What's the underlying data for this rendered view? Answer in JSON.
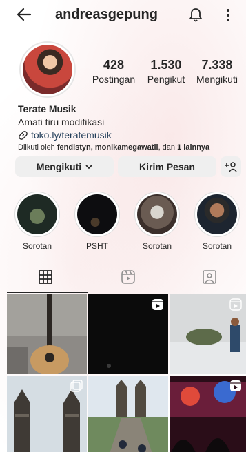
{
  "header": {
    "back_label": "←",
    "username": "andreasgepung",
    "more_label": "⋮"
  },
  "profile": {
    "stats": [
      {
        "value": "428",
        "label": "Postingan"
      },
      {
        "value": "1.530",
        "label": "Pengikut"
      },
      {
        "value": "7.338",
        "label": "Mengikuti"
      }
    ],
    "name": "Terate Musik",
    "bio": "Amati tiru modifikasi",
    "link": "toko.ly/teratemusik",
    "followed_by_prefix": "Diikuti oleh ",
    "followed_by_users": "fendistyn, monikamegawatii",
    "followed_by_middle": ", dan ",
    "followed_by_count": "1 lainnya"
  },
  "actions": {
    "following_label": "Mengikuti",
    "message_label": "Kirim Pesan",
    "add_user_label": "+"
  },
  "highlights": [
    {
      "label": "Sorotan"
    },
    {
      "label": "PSHT"
    },
    {
      "label": "Sorotan"
    },
    {
      "label": "Sorotan"
    }
  ],
  "tabs": [
    "grid-icon",
    "reels-icon",
    "tagged-icon"
  ],
  "colors": {
    "button_bg": "#efefef",
    "text": "#262626",
    "link": "#1f3b57"
  }
}
